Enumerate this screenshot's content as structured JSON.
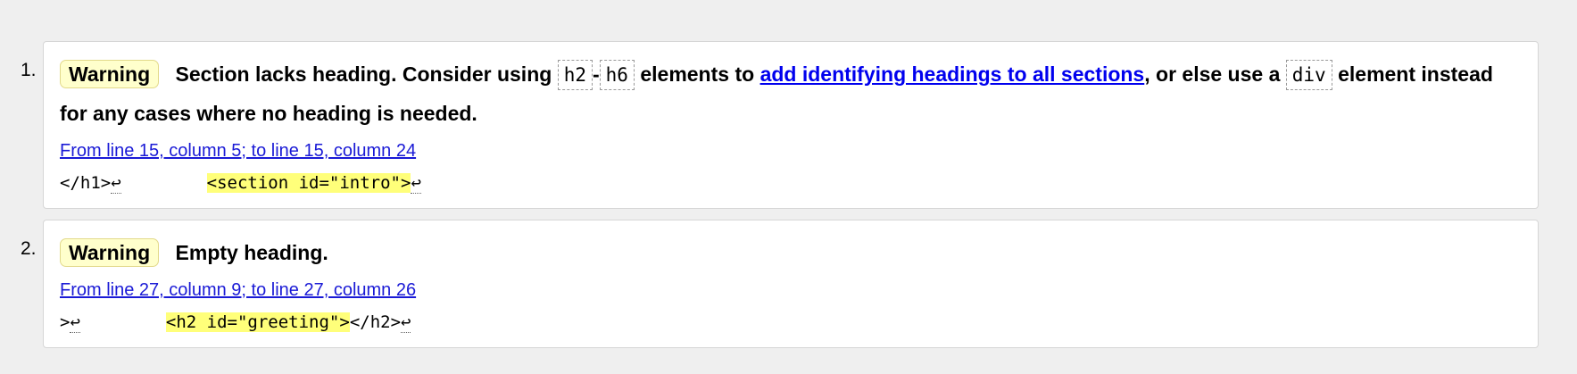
{
  "messages": [
    {
      "number": "1.",
      "type": "Warning",
      "text_1": "Section lacks heading. Consider using",
      "code_1": "h2",
      "dash": "-",
      "code_2": "h6",
      "text_2": "elements to",
      "link_text": "add identifying headings to all sections",
      "text_3": ", or else use a",
      "code_3": "div",
      "text_4": "element instead for any cases where no heading is needed.",
      "location": "From line 15, column 5; to line 15, column 24",
      "extract_before": "</h1>",
      "extract_highlight": "<section id=\"intro\">",
      "linefeed": "↩"
    },
    {
      "number": "2.",
      "type": "Warning",
      "text": "Empty heading.",
      "location": "From line 27, column 9; to line 27, column 26",
      "extract_before": ">",
      "extract_highlight": "<h2 id=\"greeting\">",
      "extract_after": "</h2>",
      "linefeed": "↩"
    }
  ]
}
